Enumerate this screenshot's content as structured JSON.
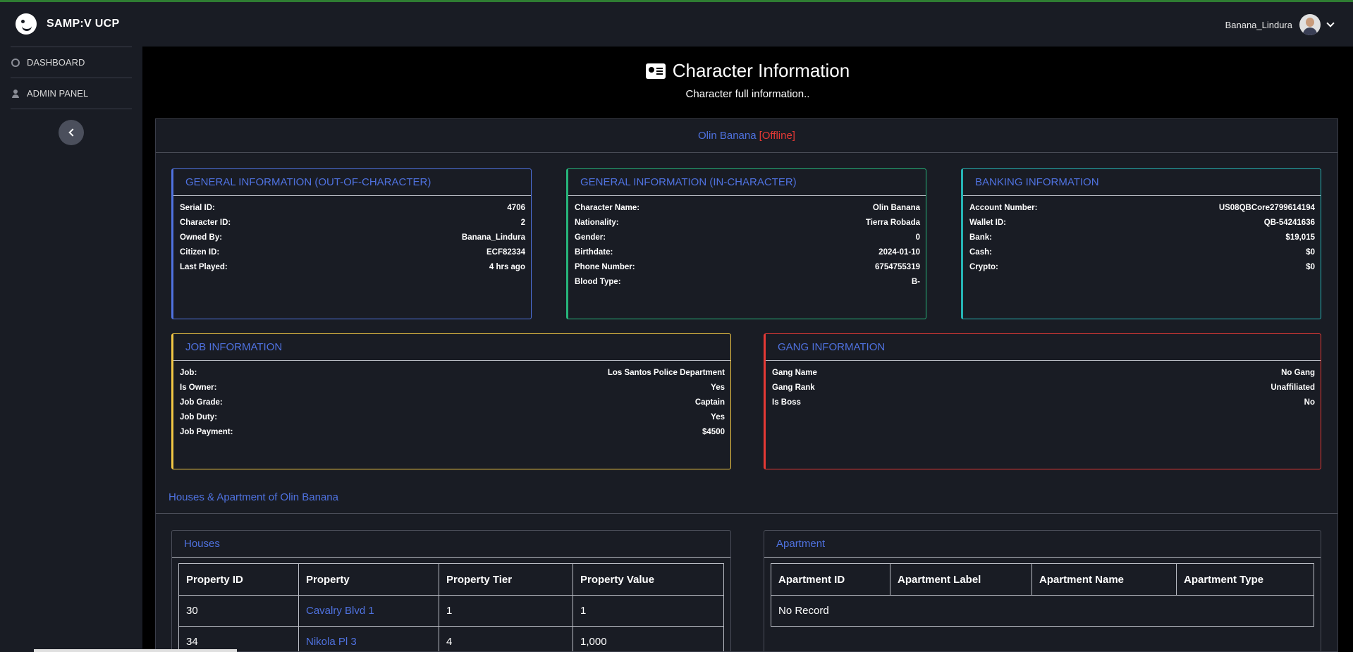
{
  "brand": {
    "name": "SAMP:V UCP"
  },
  "user": {
    "name": "Banana_Lindura"
  },
  "sidebar": {
    "items": [
      {
        "label": "DASHBOARD"
      },
      {
        "label": "ADMIN PANEL"
      }
    ]
  },
  "header": {
    "title": "Character Information",
    "subtitle": "Character full information.."
  },
  "character": {
    "name": "Olin Banana",
    "status": "[Offline]"
  },
  "colors": {
    "ooc": "#4f72e0",
    "ic": "#26b47a",
    "bank": "#26b4b4",
    "job": "#f2c744",
    "gang": "#e53935",
    "accent": "#4f72e0"
  },
  "ooc": {
    "title": "GENERAL INFORMATION (OUT-OF-CHARACTER)",
    "rows": [
      {
        "label": "Serial ID:",
        "value": "4706"
      },
      {
        "label": "Character ID:",
        "value": "2"
      },
      {
        "label": "Owned By:",
        "value": "Banana_Lindura"
      },
      {
        "label": "Citizen ID:",
        "value": "ECF82334"
      },
      {
        "label": "Last Played:",
        "value": "4 hrs ago"
      }
    ]
  },
  "ic": {
    "title": "GENERAL INFORMATION (IN-CHARACTER)",
    "rows": [
      {
        "label": "Character Name:",
        "value": "Olin Banana"
      },
      {
        "label": "Nationality:",
        "value": "Tierra Robada"
      },
      {
        "label": "Gender:",
        "value": "0"
      },
      {
        "label": "Birthdate:",
        "value": "2024-01-10"
      },
      {
        "label": "Phone Number:",
        "value": "6754755319"
      },
      {
        "label": "Blood Type:",
        "value": "B-"
      }
    ]
  },
  "bank": {
    "title": "BANKING INFORMATION",
    "rows": [
      {
        "label": "Account Number:",
        "value": "US08QBCore2799614194"
      },
      {
        "label": "Wallet ID:",
        "value": "QB-54241636"
      },
      {
        "label": "Bank:",
        "value": "$19,015"
      },
      {
        "label": "Cash:",
        "value": "$0"
      },
      {
        "label": "Crypto:",
        "value": "$0"
      }
    ]
  },
  "job": {
    "title": "JOB INFORMATION",
    "rows": [
      {
        "label": "Job:",
        "value": "Los Santos Police Department"
      },
      {
        "label": "Is Owner:",
        "value": "Yes"
      },
      {
        "label": "Job Grade:",
        "value": "Captain"
      },
      {
        "label": "Job Duty:",
        "value": "Yes"
      },
      {
        "label": "Job Payment:",
        "value": "$4500"
      }
    ]
  },
  "gang": {
    "title": "GANG INFORMATION",
    "rows": [
      {
        "label": "Gang Name",
        "value": "No Gang"
      },
      {
        "label": "Gang Rank",
        "value": "Unaffiliated"
      },
      {
        "label": "Is Boss",
        "value": "No"
      }
    ]
  },
  "properties": {
    "section_title": "Houses & Apartment of Olin Banana",
    "houses": {
      "title": "Houses",
      "columns": [
        "Property ID",
        "Property",
        "Property Tier",
        "Property Value"
      ],
      "rows": [
        [
          "30",
          "Cavalry Blvd 1",
          "1",
          "1"
        ],
        [
          "34",
          "Nikola Pl 3",
          "4",
          "1,000"
        ]
      ]
    },
    "apartment": {
      "title": "Apartment",
      "columns": [
        "Apartment ID",
        "Apartment Label",
        "Apartment Name",
        "Apartment Type"
      ],
      "empty_text": "No Record"
    }
  }
}
